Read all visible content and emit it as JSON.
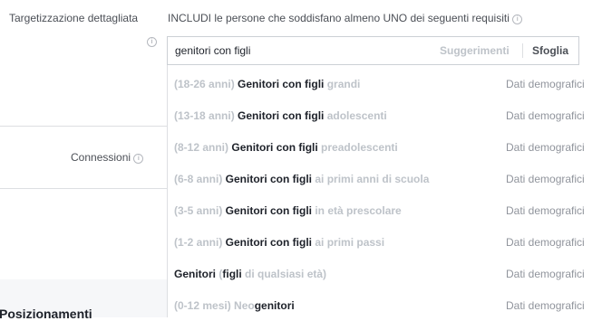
{
  "left": {
    "detailed_targeting_label": "Targetizzazione dettagliata",
    "connections_label": "Connessioni",
    "placements_label": "Posizionamenti"
  },
  "header": {
    "include_text": "INCLUDI le persone che soddisfano almeno UNO dei seguenti requisiti"
  },
  "search": {
    "value": "genitori con figli",
    "suggestions_label": "Suggerimenti",
    "browse_label": "Sfoglia"
  },
  "results": [
    {
      "pre": "(18-26 anni) ",
      "match": "Genitori con figli",
      "post": " grandi",
      "category": "Dati demografici"
    },
    {
      "pre": "(13-18 anni) ",
      "match": "Genitori con figli",
      "post": " adolescenti",
      "category": "Dati demografici"
    },
    {
      "pre": "(8-12 anni) ",
      "match": "Genitori con figli",
      "post": " preadolescenti",
      "category": "Dati demografici"
    },
    {
      "pre": "(6-8 anni) ",
      "match": "Genitori con figli",
      "post": " ai primi anni di scuola",
      "category": "Dati demografici"
    },
    {
      "pre": "(3-5 anni) ",
      "match": "Genitori con figli",
      "post": " in età prescolare",
      "category": "Dati demografici"
    },
    {
      "pre": "(1-2 anni) ",
      "match": "Genitori con figli",
      "post": " ai primi passi",
      "category": "Dati demografici"
    },
    {
      "pre": "",
      "match": "Genitori",
      "mid": " (",
      "match2": "figli",
      "post": " di qualsiasi età)",
      "category": "Dati demografici"
    },
    {
      "pre": "(0-12 mesi) Neo",
      "match": "genitori",
      "post": "",
      "category": "Dati demografici"
    }
  ]
}
